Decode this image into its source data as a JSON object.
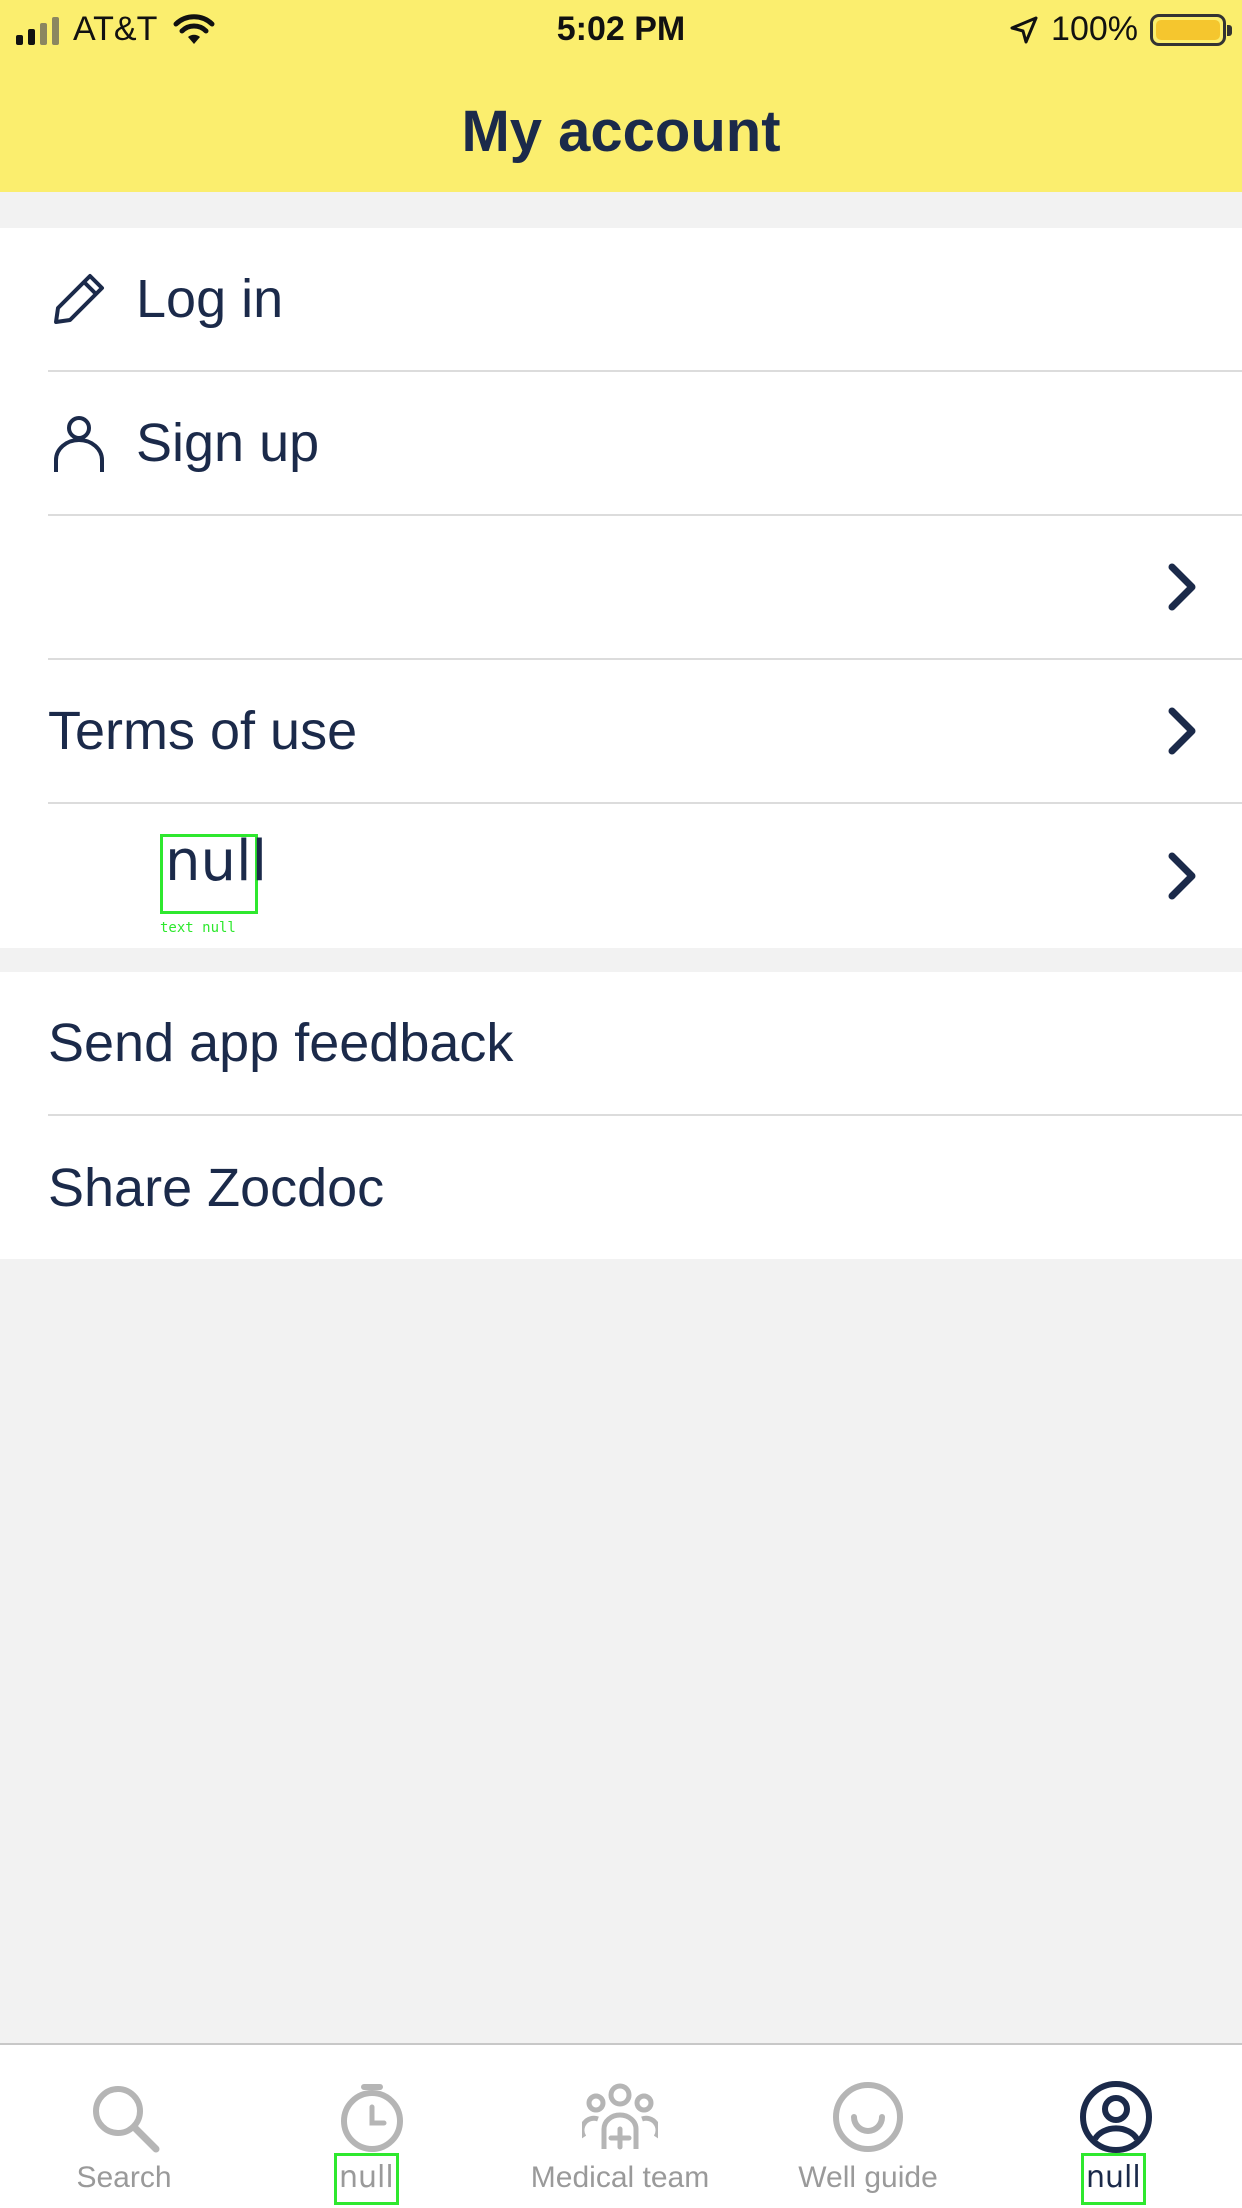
{
  "status_bar": {
    "carrier": "AT&T",
    "time": "5:02 PM",
    "battery": "100%"
  },
  "header": {
    "title": "My account"
  },
  "account_menu": {
    "items": [
      {
        "label": "Log in",
        "icon": "pencil-icon",
        "chevron": false
      },
      {
        "label": "Sign up",
        "icon": "person-icon",
        "chevron": false
      },
      {
        "label": "",
        "icon": "",
        "chevron": true
      },
      {
        "label": "Terms of use",
        "icon": "",
        "chevron": true
      },
      {
        "label": "null",
        "icon": "",
        "chevron": true
      }
    ]
  },
  "app_menu": {
    "items": [
      {
        "label": "Send app feedback"
      },
      {
        "label": "Share Zocdoc"
      }
    ]
  },
  "overlay": {
    "caption": "text null"
  },
  "tab_bar": {
    "tabs": [
      {
        "label": "Search",
        "icon": "search-icon",
        "active": false
      },
      {
        "label": "null",
        "icon": "clock-icon",
        "active": false
      },
      {
        "label": "Medical team",
        "icon": "medical-team-icon",
        "active": false
      },
      {
        "label": "Well guide",
        "icon": "smile-icon",
        "active": false
      },
      {
        "label": "null",
        "icon": "account-icon",
        "active": true
      }
    ]
  },
  "colors": {
    "header_bg": "#fbee6e",
    "text_primary": "#1b2a4a",
    "tab_inactive": "#9a9a9a",
    "page_bg": "#f2f2f2"
  }
}
